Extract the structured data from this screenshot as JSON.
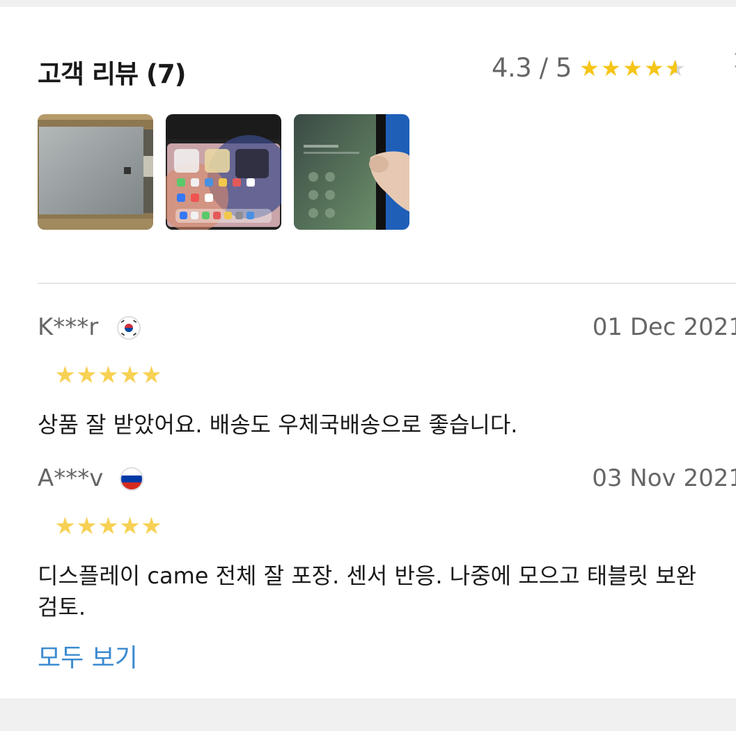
{
  "header": {
    "title": "고객 리뷰 (7)",
    "rating_text": "4.3 / 5",
    "rating_value": 4.3,
    "rating_max": 5,
    "close_icon": "close-icon"
  },
  "photos": [
    {
      "name": "review-photo-lcd-back"
    },
    {
      "name": "review-photo-ipad-homescreen"
    },
    {
      "name": "review-photo-ipad-passcode"
    }
  ],
  "reviews": [
    {
      "author": "K***r",
      "flag": "south-korea-flag-icon",
      "date": "01 Dec 2021",
      "stars": 5,
      "text": "상품 잘 받았어요. 배송도 우체국배송으로 좋습니다."
    },
    {
      "author": "A***v",
      "flag": "russia-flag-icon",
      "date": "03 Nov 2021",
      "stars": 5,
      "text": "디스플레이 came 전체 잘 포장. 센서 반응. 나중에 모으고 태블릿 보완 검토."
    }
  ],
  "view_all_label": "모두 보기",
  "colors": {
    "accent": "#3b8bd0",
    "star": "#f5c518",
    "star_review": "#f7d154",
    "muted_text": "#666666"
  }
}
